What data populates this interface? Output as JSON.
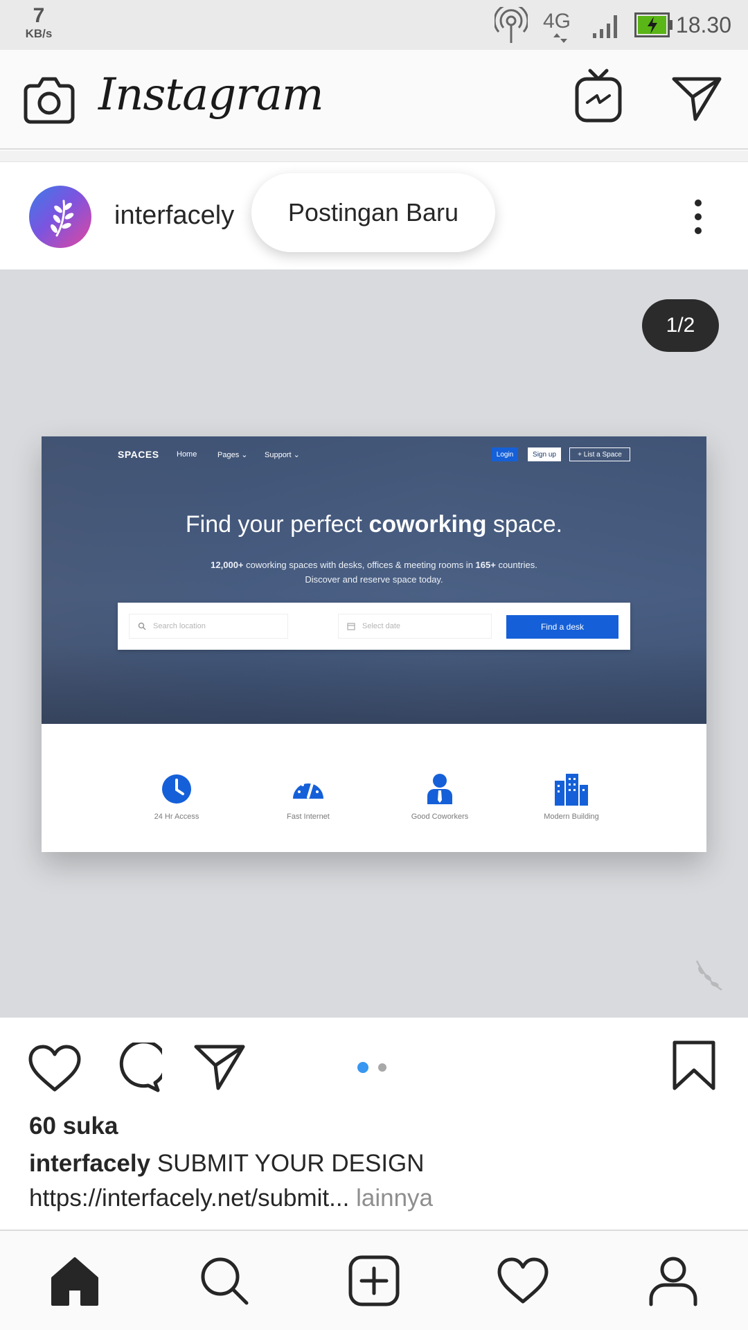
{
  "status_bar": {
    "speed_value": "7",
    "speed_unit": "KB/s",
    "network": "4G",
    "time": "18.30",
    "icons": [
      "hotspot-icon",
      "network-4g-icon",
      "signal-icon",
      "battery-charging-icon"
    ]
  },
  "header": {
    "logo": "Instagram",
    "icons": [
      "camera-icon",
      "igtv-icon",
      "direct-message-icon"
    ]
  },
  "post": {
    "username": "interfacely",
    "toast": "Postingan Baru",
    "counter": "1/2",
    "likes": "60 suka",
    "caption_user": "interfacely",
    "caption_text": "SUBMIT YOUR DESIGN",
    "caption_link": "https://interfacely.net/submit",
    "caption_ellipsis": "...",
    "more_label": "lainnya",
    "carousel_index": 1,
    "carousel_total": 2,
    "colors": {
      "active_dot": "#3897f0",
      "inactive_dot": "#a8a8a8"
    }
  },
  "mockup": {
    "brand": "SPACES",
    "nav": [
      "Home",
      "Pages",
      "Support"
    ],
    "login": "Login",
    "signup": "Sign up",
    "list_space": "+ List a Space",
    "title_pre": "Find your perfect ",
    "title_bold": "coworking",
    "title_post": " space.",
    "sub_line1_a": "12,000+",
    "sub_line1_b": " coworking spaces with desks, offices & meeting rooms in ",
    "sub_line1_c": "165+",
    "sub_line1_d": " countries.",
    "sub_line2": "Discover and reserve space today.",
    "search_placeholder": "Search location",
    "date_placeholder": "Select date",
    "find_button": "Find a desk",
    "features": [
      "24 Hr Access",
      "Fast Internet",
      "Good Coworkers",
      "Modern Building"
    ],
    "accent": "#1560d8"
  },
  "bottom_nav": [
    "home-icon",
    "search-icon",
    "add-post-icon",
    "activity-heart-icon",
    "profile-icon"
  ]
}
